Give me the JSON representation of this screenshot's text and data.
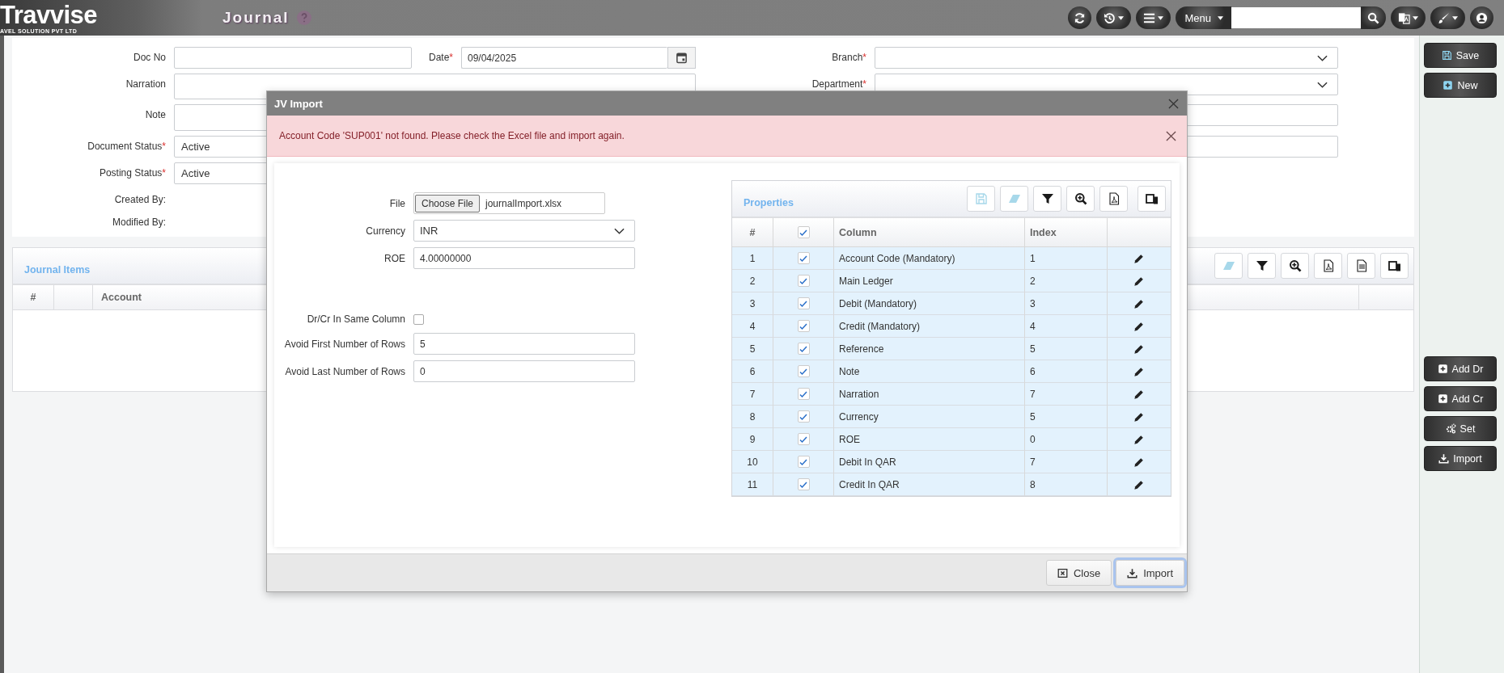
{
  "header": {
    "logo": "Travvise",
    "logo_tagline": "AVEL SOLUTION PVT LTD",
    "title": "Journal",
    "menu_button": "Menu"
  },
  "form": {
    "doc_no": {
      "label": "Doc No"
    },
    "date": {
      "label": "Date",
      "mark": "*",
      "value": "09/04/2025"
    },
    "branch": {
      "label": "Branch",
      "mark": "*"
    },
    "narration": {
      "label": "Narration"
    },
    "department": {
      "label": "Department",
      "mark": "*"
    },
    "note": {
      "label": "Note"
    },
    "document_status": {
      "label": "Document Status",
      "mark": "*",
      "value": "Active"
    },
    "posting_status": {
      "label": "Posting Status",
      "mark": "*",
      "value": "Active"
    },
    "created_by": {
      "label": "Created By:"
    },
    "modified_by": {
      "label": "Modified By:"
    }
  },
  "journal_items": {
    "title": "Journal Items",
    "columns": [
      "#",
      "Account"
    ],
    "tools": [
      {
        "kind": "eraser",
        "disabled": true
      },
      {
        "kind": "filter",
        "disabled": false
      },
      {
        "kind": "zoom",
        "disabled": false
      },
      {
        "kind": "pdf",
        "disabled": false
      },
      {
        "kind": "xlsx",
        "disabled": false
      },
      {
        "kind": "columns",
        "disabled": false
      }
    ]
  },
  "actions": [
    {
      "kind": "save",
      "label": "Save"
    },
    {
      "kind": "new",
      "label": "New"
    }
  ],
  "row_actions": [
    {
      "kind": "add",
      "label": "Add Dr"
    },
    {
      "kind": "add",
      "label": "Add Cr"
    },
    {
      "kind": "set",
      "label": "Set"
    },
    {
      "kind": "import",
      "label": "Import"
    }
  ],
  "dialog": {
    "title": "JV Import",
    "alert": "Account Code 'SUP001' not found. Please check the Excel file and import again.",
    "file": {
      "label": "File",
      "button": "Choose File",
      "value": "journalImport.xlsx"
    },
    "currency": {
      "label": "Currency",
      "value": "INR"
    },
    "roe": {
      "label": "ROE",
      "value": "4.00000000"
    },
    "same_column": {
      "label": "Dr/Cr In Same Column",
      "checked": false
    },
    "avoid_first": {
      "label": "Avoid First Number of Rows",
      "value": "5"
    },
    "avoid_last": {
      "label": "Avoid Last Number of Rows",
      "value": "0"
    },
    "properties": {
      "title": "Properties",
      "all_checked": true,
      "columns": [
        "#",
        "Column",
        "Index"
      ],
      "tools": [
        {
          "kind": "save",
          "disabled": true
        },
        {
          "kind": "eraser",
          "disabled": true
        },
        {
          "kind": "filter",
          "disabled": false
        },
        {
          "kind": "zoom",
          "disabled": false
        },
        {
          "kind": "pdf",
          "disabled": false
        },
        {
          "kind": "columns",
          "disabled": false
        }
      ],
      "rows": [
        {
          "number": "1",
          "checked": true,
          "column": "Account Code (Mandatory)",
          "index": "1"
        },
        {
          "number": "2",
          "checked": true,
          "column": "Main Ledger",
          "index": "2"
        },
        {
          "number": "3",
          "checked": true,
          "column": "Debit (Mandatory)",
          "index": "3"
        },
        {
          "number": "4",
          "checked": true,
          "column": "Credit (Mandatory)",
          "index": "4"
        },
        {
          "number": "5",
          "checked": true,
          "column": "Reference",
          "index": "5"
        },
        {
          "number": "6",
          "checked": true,
          "column": "Note",
          "index": "6"
        },
        {
          "number": "7",
          "checked": true,
          "column": "Narration",
          "index": "7"
        },
        {
          "number": "8",
          "checked": true,
          "column": "Currency",
          "index": "5"
        },
        {
          "number": "9",
          "checked": true,
          "column": "ROE",
          "index": "0"
        },
        {
          "number": "10",
          "checked": true,
          "column": "Debit In QAR",
          "index": "7"
        },
        {
          "number": "11",
          "checked": true,
          "column": "Credit In QAR",
          "index": "8"
        }
      ]
    },
    "buttons": [
      {
        "kind": "close",
        "label": "Close",
        "focused": false
      },
      {
        "kind": "import",
        "label": "Import",
        "focused": true
      }
    ]
  }
}
